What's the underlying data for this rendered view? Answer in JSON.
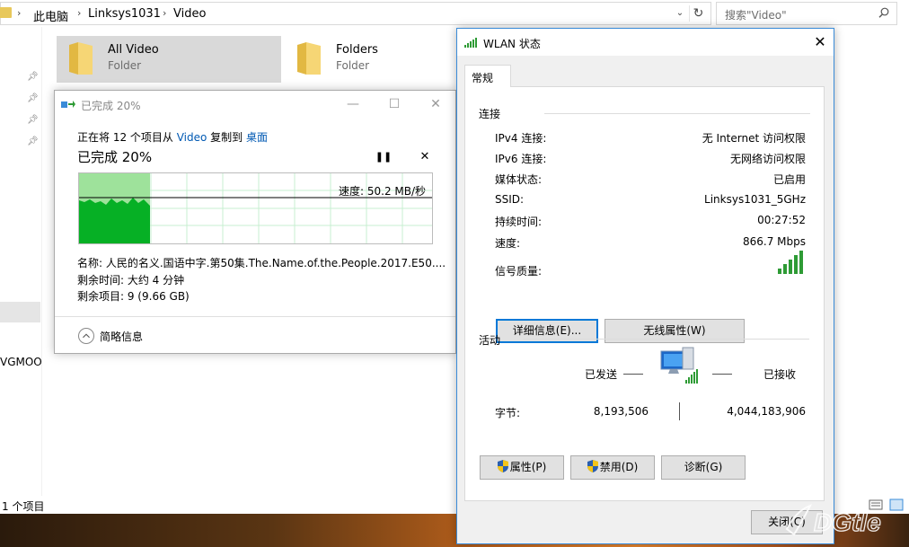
{
  "explorer": {
    "breadcrumbs": [
      "此电脑",
      "Linksys1031",
      "Video"
    ],
    "search_placeholder": "搜索\"Video\"",
    "nav_partial_text": "VGMOO",
    "status": "1 个项目",
    "items": [
      {
        "name": "All Video",
        "type": "Folder"
      },
      {
        "name": "Folders",
        "type": "Folder"
      }
    ]
  },
  "copy_dialog": {
    "title": "已完成 20%",
    "desc_prefix": "正在将 12 个项目从 ",
    "desc_src": "Video",
    "desc_mid": " 复制到 ",
    "desc_dst": "桌面",
    "progress_label": "已完成 20%",
    "progress_fraction": 0.2,
    "speed": "速度: 50.2 MB/秒",
    "name_line": "名称: 人民的名义.国语中字.第50集.The.Name.of.the.People.2017.E50....",
    "time_line": "剩余时间: 大约 4 分钟",
    "items_line": "剩余项目: 9 (9.66 GB)",
    "fewer_details": "简略信息"
  },
  "wlan": {
    "title": "WLAN 状态",
    "tab": "常规",
    "connection_header": "连接",
    "rows": [
      {
        "label": "IPv4 连接:",
        "value": "无 Internet 访问权限"
      },
      {
        "label": "IPv6 连接:",
        "value": "无网络访问权限"
      },
      {
        "label": "媒体状态:",
        "value": "已启用"
      },
      {
        "label": "SSID:",
        "value": "Linksys1031_5GHz"
      },
      {
        "label": "持续时间:",
        "value": "00:27:52"
      },
      {
        "label": "速度:",
        "value": "866.7 Mbps"
      }
    ],
    "signal_label": "信号质量:",
    "signal_level": 5,
    "details_button": "详细信息(E)...",
    "wireless_props_button": "无线属性(W)",
    "activity_header": "活动",
    "sent_label": "已发送",
    "received_label": "已接收",
    "bytes_label": "字节:",
    "bytes_sent": "8,193,506",
    "bytes_received": "4,044,183,906",
    "properties_button": "属性(P)",
    "disable_button": "禁用(D)",
    "diagnose_button": "诊断(G)",
    "close_button": "关闭(C)"
  },
  "watermark": "DGtle",
  "colors": {
    "accent_border": "#3a8bd8",
    "progress_green": "#06b025",
    "link_blue": "#0059b3",
    "signal_green": "#2e9b35"
  }
}
